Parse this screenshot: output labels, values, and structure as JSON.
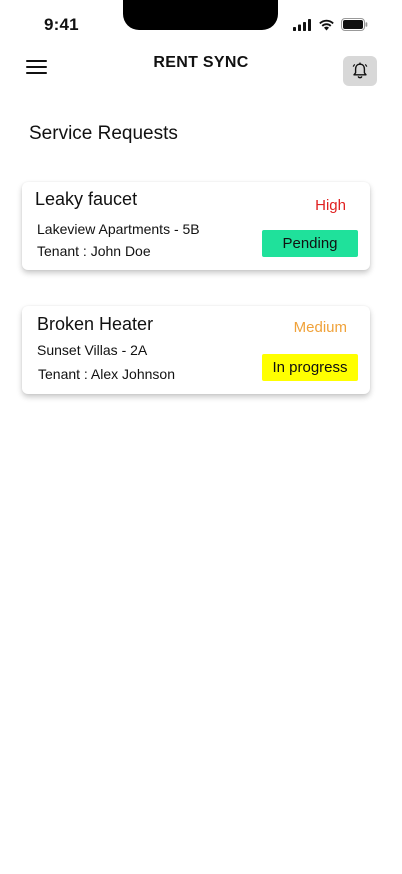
{
  "status_bar": {
    "time": "9:41"
  },
  "header": {
    "title": "RENT SYNC",
    "menu_icon": "hamburger-menu-icon",
    "bell_icon": "bell-icon"
  },
  "page": {
    "title": "Service Requests"
  },
  "requests": [
    {
      "title": "Leaky faucet",
      "location": "Lakeview Apartments - 5B",
      "tenant": "Tenant : John Doe",
      "priority": "High",
      "priority_color": "#e02020",
      "status": "Pending",
      "status_bg": "#1fe19b"
    },
    {
      "title": "Broken Heater",
      "location": "Sunset Villas - 2A",
      "tenant": "Tenant : Alex Johnson",
      "priority": "Medium",
      "priority_color": "#f0a23a",
      "status": "In progress",
      "status_bg": "#ffff00"
    }
  ]
}
